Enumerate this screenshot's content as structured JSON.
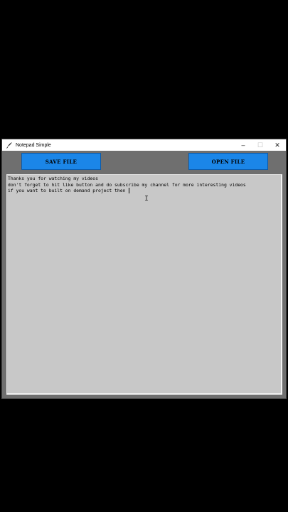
{
  "window": {
    "title": "Notepad Simple",
    "controls": {
      "minimize": "–",
      "maximize": "☐",
      "close": "✕"
    }
  },
  "toolbar": {
    "save_label": "SAVE FILE",
    "open_label": "OPEN FILE"
  },
  "editor": {
    "lines": [
      "Thanks you for watching my videos",
      "don't forget to hit like button and do subscribe my channel for more interesting videos",
      "if you want to built on demand project then "
    ]
  },
  "colors": {
    "button_bg": "#1b86e8",
    "window_bg": "#6f6f6f",
    "editor_bg": "#c8c8c8"
  },
  "icons": {
    "app": "feather-pen-icon",
    "cursor": "text-cursor-icon"
  }
}
